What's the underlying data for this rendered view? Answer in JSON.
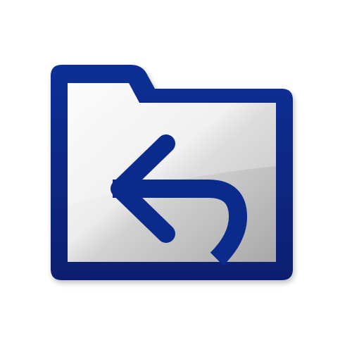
{
  "icon": {
    "name": "folder-back-arrow-icon",
    "colors": {
      "frame": "#0a2a8c",
      "frame_dark": "#061f6c",
      "arrow": "#0a2a8c",
      "panel_light": "#f7f7f7",
      "panel_mid": "#d6d6d6",
      "panel_dark": "#a9a9a9",
      "background": "#ffffff"
    }
  }
}
